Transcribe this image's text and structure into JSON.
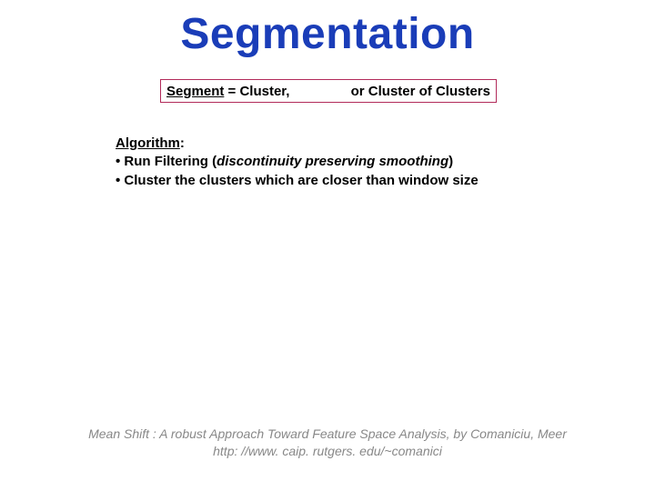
{
  "title": "Segmentation",
  "box": {
    "segment_word": "Segment",
    "equals_cluster": " = Cluster,",
    "right": "or Cluster of Clusters"
  },
  "algorithm": {
    "heading": "Algorithm",
    "colon": ":",
    "bullet1_prefix": "• Run Filtering (",
    "bullet1_italic": "discontinuity preserving smoothing",
    "bullet1_suffix": ")",
    "bullet2": "• Cluster the clusters which are closer than window size"
  },
  "citation": {
    "line1": "Mean Shift : A robust Approach Toward Feature Space Analysis, by Comaniciu, Meer",
    "line2": "http: //www. caip. rutgers. edu/~comanici"
  }
}
